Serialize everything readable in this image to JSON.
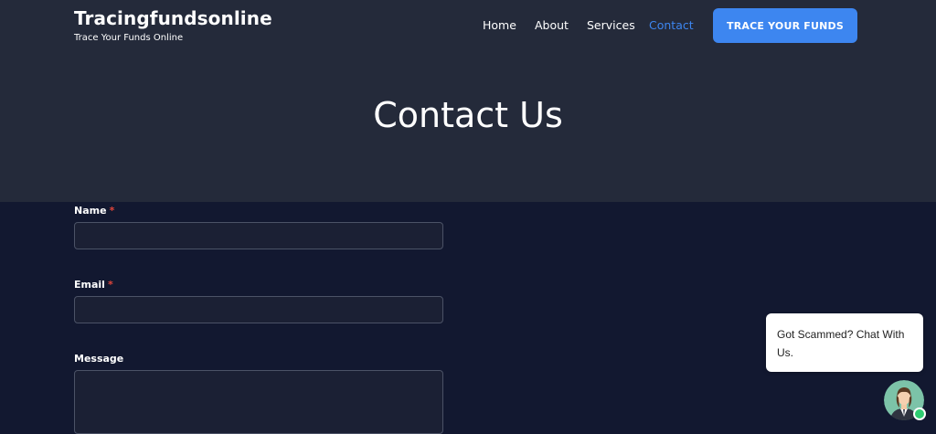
{
  "brand": {
    "title": "Tracingfundsonline",
    "tagline": "Trace Your Funds Online"
  },
  "nav": {
    "items": [
      {
        "label": "Home",
        "active": false
      },
      {
        "label": "About",
        "active": false
      },
      {
        "label": "Services",
        "active": false
      },
      {
        "label": "Contact",
        "active": true
      }
    ],
    "cta_label": "TRACE YOUR FUNDS"
  },
  "page": {
    "title": "Contact Us"
  },
  "form": {
    "name_label": "Name",
    "email_label": "Email",
    "message_label": "Message",
    "required_mark": "*",
    "name_value": "",
    "email_value": "",
    "message_value": ""
  },
  "chat": {
    "bubble_text": "Got Scammed? Chat With Us.",
    "avatar_icon": "support-agent-avatar-icon",
    "status": "online"
  },
  "colors": {
    "hero_bg": "#242a3a",
    "body_bg": "#121830",
    "accent": "#3d86f0",
    "required": "#e0453a"
  }
}
